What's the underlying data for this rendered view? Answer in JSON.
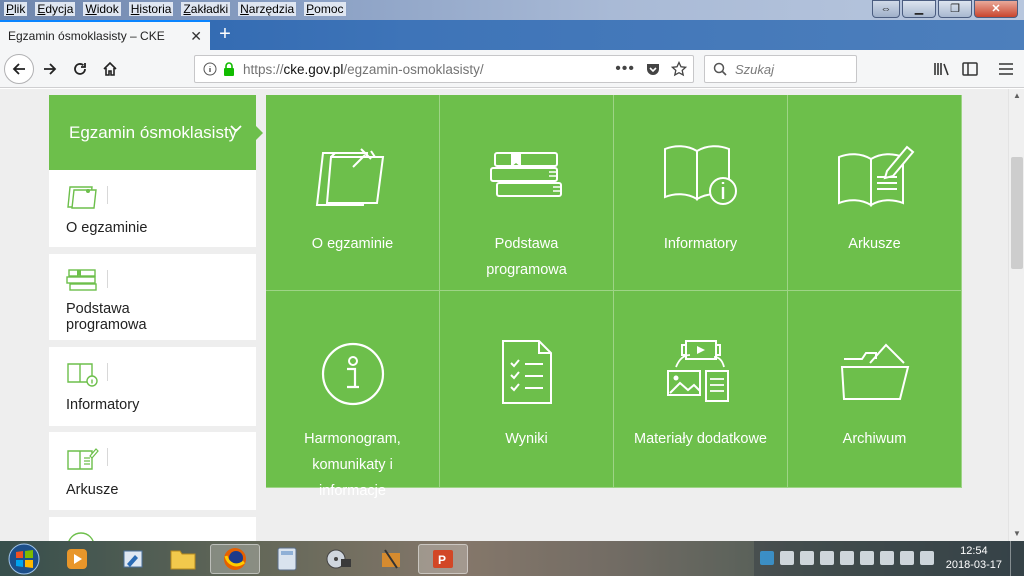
{
  "menu": [
    "Plik",
    "Edycja",
    "Widok",
    "Historia",
    "Zakładki",
    "Narzędzia",
    "Pomoc"
  ],
  "tab": {
    "title": "Egzamin ósmoklasisty – CKE"
  },
  "address": {
    "scheme": "https://",
    "host": "cke.gov.pl",
    "path": "/egzamin-osmoklasisty/"
  },
  "search": {
    "placeholder": "Szukaj"
  },
  "sidebar": {
    "header": "Egzamin ósmoklasisty",
    "items": [
      {
        "label": "O egzaminie",
        "icon": "notes-pin-icon"
      },
      {
        "label": "Podstawa programowa",
        "icon": "books-icon"
      },
      {
        "label": "Informatory",
        "icon": "book-info-icon"
      },
      {
        "label": "Arkusze",
        "icon": "book-pen-icon"
      }
    ]
  },
  "tiles": [
    {
      "label": "O egzaminie",
      "icon": "notes-pin-icon"
    },
    {
      "label": "Podstawa programowa",
      "icon": "books-icon"
    },
    {
      "label": "Informatory",
      "icon": "book-info-icon"
    },
    {
      "label": "Arkusze",
      "icon": "book-pen-icon"
    },
    {
      "label": "Harmonogram, komunikaty i informacje",
      "icon": "info-circle-icon"
    },
    {
      "label": "Wyniki",
      "icon": "checklist-icon"
    },
    {
      "label": "Materiały dodatkowe",
      "icon": "media-files-icon"
    },
    {
      "label": "Archiwum",
      "icon": "folder-open-icon"
    }
  ],
  "clock": {
    "time": "12:54",
    "date": "2018-03-17"
  },
  "colors": {
    "accent": "#6dbf4b",
    "firefox_blue": "#0a84ff"
  }
}
